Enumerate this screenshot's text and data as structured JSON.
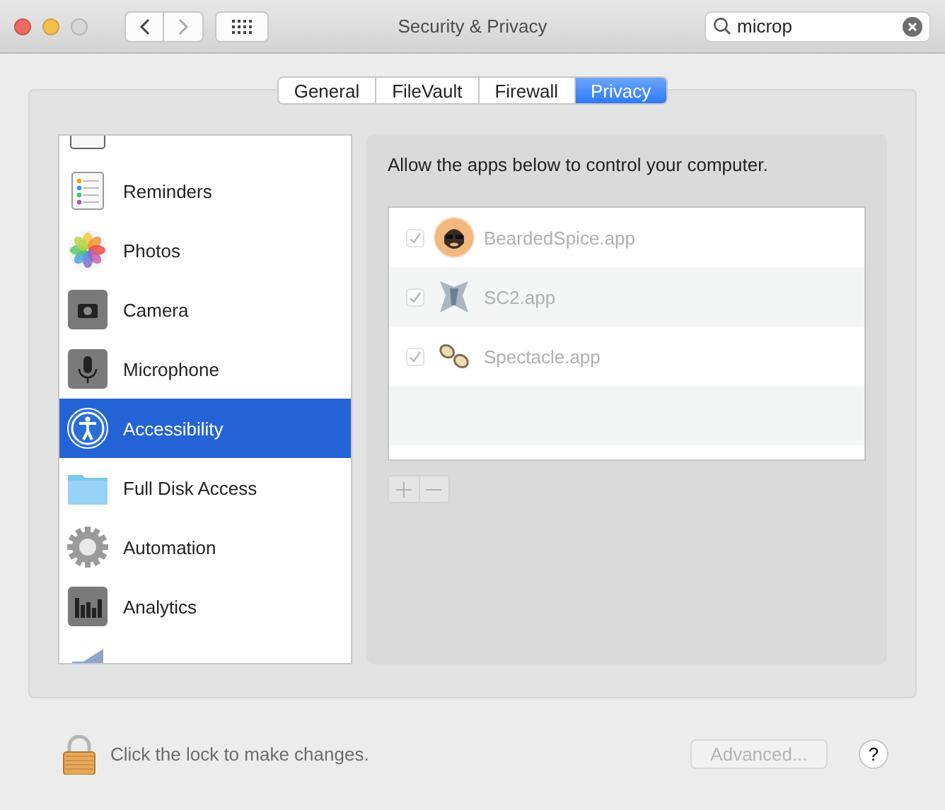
{
  "window": {
    "title": "Security & Privacy"
  },
  "search": {
    "value": "microp"
  },
  "tabs": [
    {
      "label": "General",
      "selected": false
    },
    {
      "label": "FileVault",
      "selected": false
    },
    {
      "label": "Firewall",
      "selected": false
    },
    {
      "label": "Privacy",
      "selected": true
    }
  ],
  "sidebar": {
    "items": [
      {
        "kind": "calendar",
        "selected": false
      },
      {
        "kind": "reminders",
        "label": "Reminders",
        "selected": false
      },
      {
        "kind": "photos",
        "label": "Photos",
        "selected": false
      },
      {
        "kind": "camera",
        "label": "Camera",
        "selected": false
      },
      {
        "kind": "microphone",
        "label": "Microphone",
        "selected": false
      },
      {
        "kind": "accessibility",
        "label": "Accessibility",
        "selected": true
      },
      {
        "kind": "folder",
        "label": "Full Disk Access",
        "selected": false
      },
      {
        "kind": "gear",
        "label": "Automation",
        "selected": false
      },
      {
        "kind": "analytics",
        "label": "Analytics",
        "selected": false
      },
      {
        "kind": "megaphone",
        "selected": false
      }
    ]
  },
  "panel": {
    "description": "Allow the apps below to control your computer.",
    "apps": [
      {
        "kind": "face",
        "name": "BeardedSpice.app",
        "checked": true,
        "disabled": true
      },
      {
        "kind": "emblem",
        "name": "SC2.app",
        "checked": true,
        "disabled": true
      },
      {
        "kind": "glasses",
        "name": "Spectacle.app",
        "checked": true,
        "disabled": true
      }
    ],
    "add_remove_disabled": true
  },
  "footer": {
    "lock_text": "Click the lock to make changes.",
    "advanced_button": "Advanced...",
    "advanced_disabled": true,
    "help": "?"
  }
}
